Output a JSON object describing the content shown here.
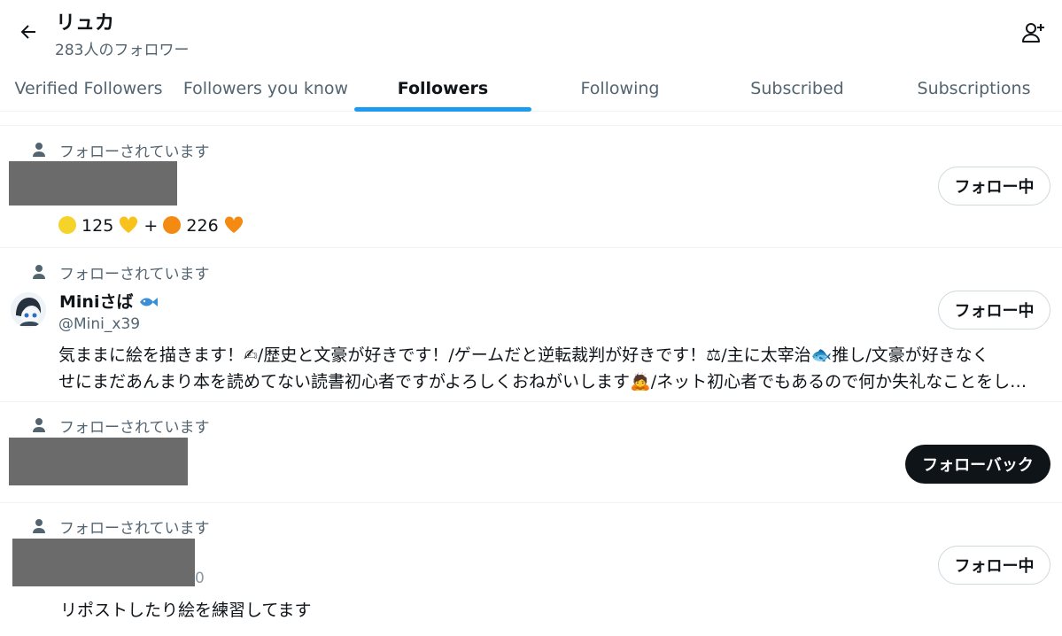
{
  "header": {
    "title": "リュカ",
    "subtitle": "283人のフォロワー"
  },
  "tabs": [
    {
      "label": "Verified Followers"
    },
    {
      "label": "Followers you know"
    },
    {
      "label": "Followers",
      "active": true
    },
    {
      "label": "Following"
    },
    {
      "label": "Subscribed"
    },
    {
      "label": "Subscriptions"
    }
  ],
  "users": [
    {
      "follows_you": "フォローされています",
      "bio_parts": [
        "125",
        "+",
        "226"
      ],
      "button": "フォロー中"
    },
    {
      "follows_you": "フォローされています",
      "name": "Miniさば",
      "handle": "@Mini_x39",
      "bio_line1": "気ままに絵を描きます！✍/歴史と文豪が好きです！/ゲームだと逆転裁判が好きです！⚖/主に太宰治🐟推し/文豪が好きなく",
      "bio_line2": "せにまだあんまり本を読めてない読書初心者ですがよろしくおねがいします🙇/ネット初心者でもあるので何か失礼なことをし…",
      "button": "フォロー中"
    },
    {
      "follows_you": "フォローされています",
      "button": "フォローバック"
    },
    {
      "follows_you": "フォローされています",
      "handle_fragment": "0",
      "bio": "リポストしたり絵を練習してます",
      "button": "フォロー中"
    }
  ],
  "colors": {
    "accent": "#1d9bf0",
    "text": "#0f1419",
    "muted": "#536471",
    "redaction": "#6b6b6b"
  }
}
